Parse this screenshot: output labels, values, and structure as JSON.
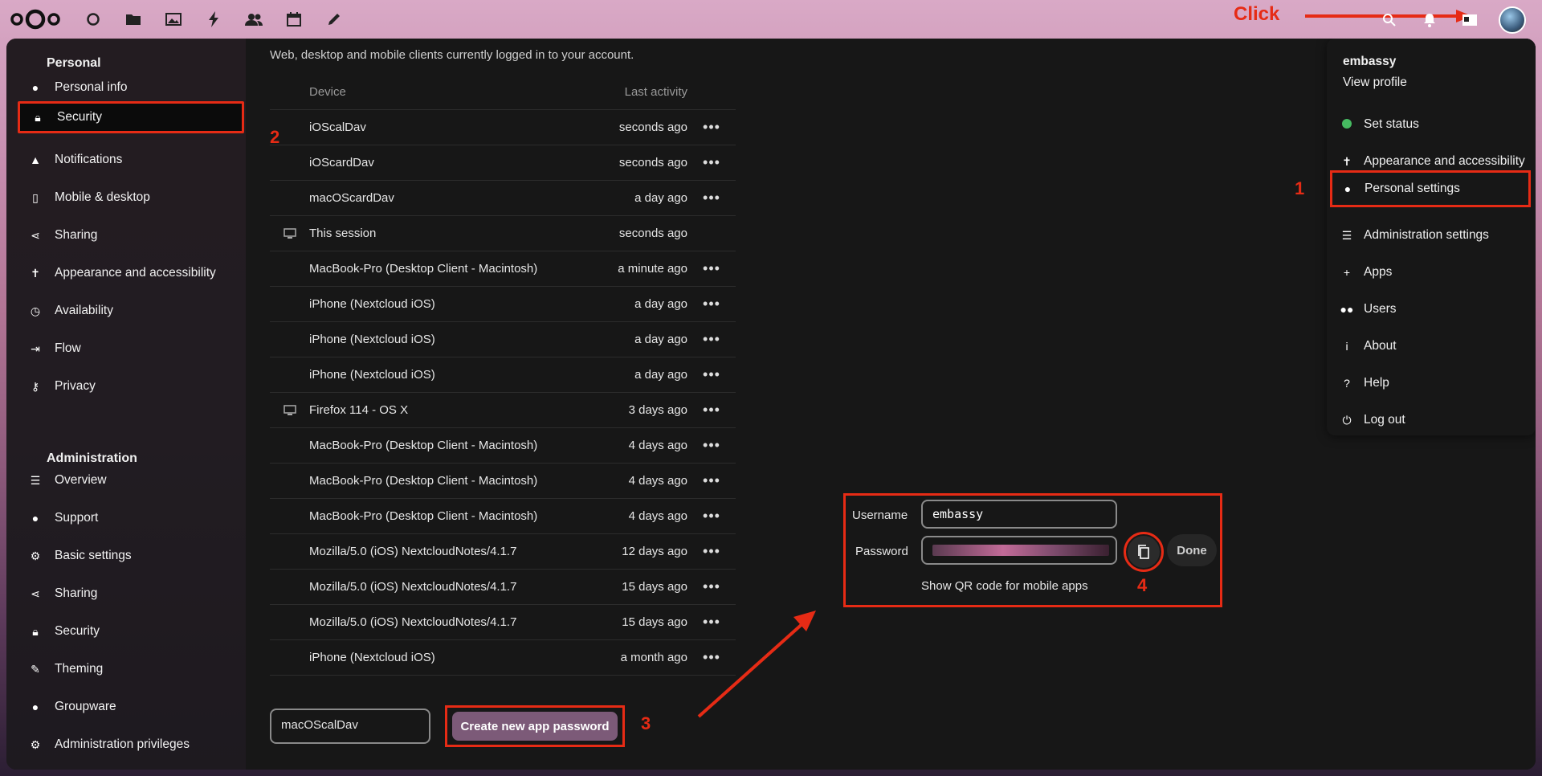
{
  "annotations": {
    "click_label": "Click",
    "step1": "1",
    "step2": "2",
    "step3": "3",
    "step4": "4",
    "color": "#e62b15"
  },
  "topbar": {
    "apps": [
      "dashboard-icon",
      "files-icon",
      "photos-icon",
      "activity-icon",
      "contacts-icon",
      "calendar-icon",
      "notes-icon"
    ],
    "right": [
      "search-icon",
      "notifications-icon",
      "contacts-menu-icon",
      "avatar"
    ]
  },
  "sidebar": {
    "personal_heading": "Personal",
    "personal_items": [
      {
        "label": "Personal info",
        "icon": "person-icon"
      },
      {
        "label": "Security",
        "icon": "lock-icon"
      },
      {
        "label": "Notifications",
        "icon": "bell-icon"
      },
      {
        "label": "Mobile & desktop",
        "icon": "phone-icon"
      },
      {
        "label": "Sharing",
        "icon": "share-icon"
      },
      {
        "label": "Appearance and accessibility",
        "icon": "accessibility-icon"
      },
      {
        "label": "Availability",
        "icon": "clock-icon"
      },
      {
        "label": "Flow",
        "icon": "flow-icon"
      },
      {
        "label": "Privacy",
        "icon": "key-icon"
      }
    ],
    "admin_heading": "Administration",
    "admin_items": [
      {
        "label": "Overview",
        "icon": "list-icon"
      },
      {
        "label": "Support",
        "icon": "chat-icon"
      },
      {
        "label": "Basic settings",
        "icon": "gear-icon"
      },
      {
        "label": "Sharing",
        "icon": "share-icon"
      },
      {
        "label": "Security",
        "icon": "lock-icon"
      },
      {
        "label": "Theming",
        "icon": "brush-icon"
      },
      {
        "label": "Groupware",
        "icon": "groupware-icon"
      },
      {
        "label": "Administration privileges",
        "icon": "gear-icon"
      }
    ]
  },
  "main": {
    "intro": "Web, desktop and mobile clients currently logged in to your account.",
    "columns": {
      "device": "Device",
      "activity": "Last activity"
    },
    "sessions": [
      {
        "device": "iOScalDav",
        "activity": "seconds ago",
        "icon": "",
        "more": true
      },
      {
        "device": "iOScardDav",
        "activity": "seconds ago",
        "icon": "",
        "more": true
      },
      {
        "device": "macOScardDav",
        "activity": "a day ago",
        "icon": "",
        "more": true
      },
      {
        "device": "This session",
        "activity": "seconds ago",
        "icon": "monitor-icon",
        "more": false
      },
      {
        "device": "MacBook-Pro (Desktop Client - Macintosh)",
        "activity": "a minute ago",
        "icon": "",
        "more": true
      },
      {
        "device": "iPhone (Nextcloud iOS)",
        "activity": "a day ago",
        "icon": "",
        "more": true
      },
      {
        "device": "iPhone (Nextcloud iOS)",
        "activity": "a day ago",
        "icon": "",
        "more": true
      },
      {
        "device": "iPhone (Nextcloud iOS)",
        "activity": "a day ago",
        "icon": "",
        "more": true
      },
      {
        "device": "Firefox 114 - OS X",
        "activity": "3 days ago",
        "icon": "monitor-icon",
        "more": true
      },
      {
        "device": "MacBook-Pro (Desktop Client - Macintosh)",
        "activity": "4 days ago",
        "icon": "",
        "more": true
      },
      {
        "device": "MacBook-Pro (Desktop Client - Macintosh)",
        "activity": "4 days ago",
        "icon": "",
        "more": true
      },
      {
        "device": "MacBook-Pro (Desktop Client - Macintosh)",
        "activity": "4 days ago",
        "icon": "",
        "more": true
      },
      {
        "device": "Mozilla/5.0 (iOS) NextcloudNotes/4.1.7",
        "activity": "12 days ago",
        "icon": "",
        "more": true
      },
      {
        "device": "Mozilla/5.0 (iOS) NextcloudNotes/4.1.7",
        "activity": "15 days ago",
        "icon": "",
        "more": true
      },
      {
        "device": "Mozilla/5.0 (iOS) NextcloudNotes/4.1.7",
        "activity": "15 days ago",
        "icon": "",
        "more": true
      },
      {
        "device": "iPhone (Nextcloud iOS)",
        "activity": "a month ago",
        "icon": "",
        "more": true
      }
    ],
    "app_name_value": "macOScalDav",
    "create_button": "Create new app password"
  },
  "credentials": {
    "username_label": "Username",
    "username_value": "embassy",
    "password_label": "Password",
    "done": "Done",
    "qr": "Show QR code for mobile apps"
  },
  "menu": {
    "username": "embassy",
    "view_profile": "View profile",
    "items": [
      {
        "label": "Set status",
        "icon": "status-dot"
      },
      {
        "label": "Appearance and accessibility",
        "icon": "accessibility-icon"
      },
      {
        "label": "Personal settings",
        "icon": "person-icon"
      },
      {
        "label": "Administration settings",
        "icon": "list-icon"
      },
      {
        "label": "Apps",
        "icon": "plus-icon"
      },
      {
        "label": "Users",
        "icon": "users-icon"
      },
      {
        "label": "About",
        "icon": "info-icon"
      },
      {
        "label": "Help",
        "icon": "help-icon"
      },
      {
        "label": "Log out",
        "icon": "power-icon"
      }
    ]
  }
}
